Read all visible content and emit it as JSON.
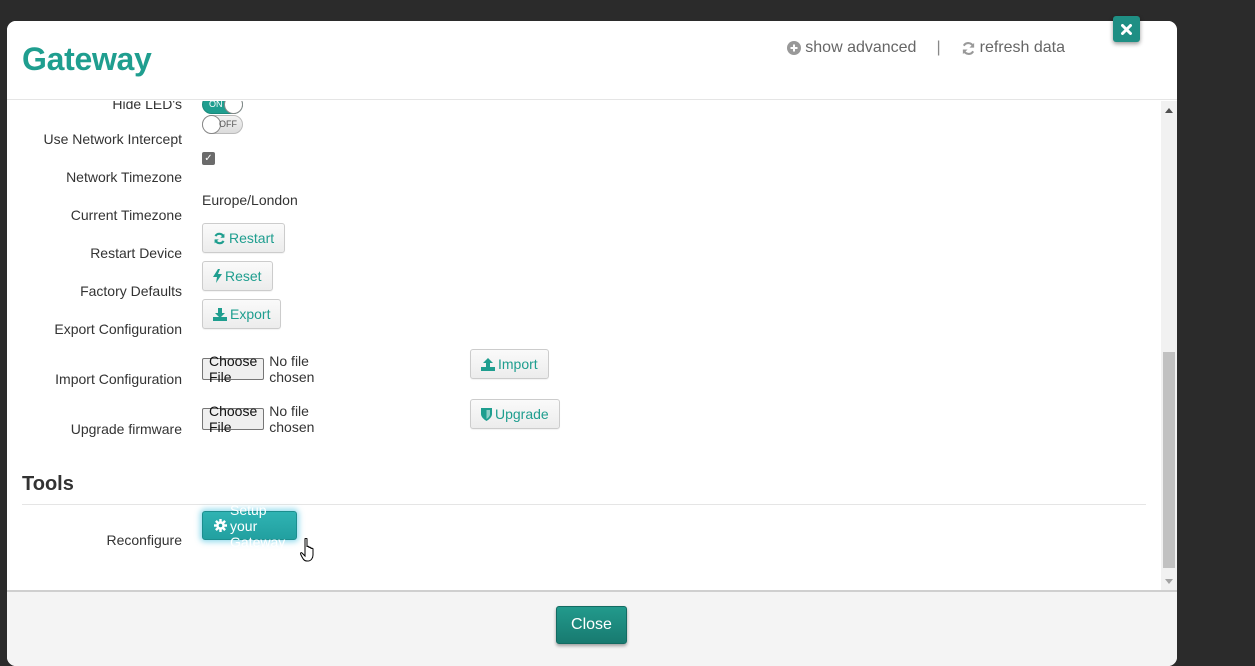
{
  "modal": {
    "title": "Gateway",
    "header_links": {
      "show_advanced": "show advanced",
      "separator": "|",
      "refresh_data": "refresh data"
    }
  },
  "settings": {
    "hide_leds": {
      "label": "Hide LED's",
      "state": "ON"
    },
    "network_intercept": {
      "label": "Use Network Intercept",
      "state": "OFF"
    },
    "network_timezone": {
      "label": "Network Timezone",
      "checked": true
    },
    "current_timezone": {
      "label": "Current Timezone",
      "value": "Europe/London"
    },
    "restart_device": {
      "label": "Restart Device",
      "button": "Restart"
    },
    "factory_defaults": {
      "label": "Factory Defaults",
      "button": "Reset"
    },
    "export_configuration": {
      "label": "Export Configuration",
      "button": "Export"
    },
    "import_configuration": {
      "label": "Import Configuration",
      "file_button": "Choose File",
      "file_status": "No file chosen",
      "button": "Import"
    },
    "upgrade_firmware": {
      "label": "Upgrade firmware",
      "file_button": "Choose File",
      "file_status": "No file chosen",
      "button": "Upgrade"
    }
  },
  "tools": {
    "title": "Tools",
    "reconfigure": {
      "label": "Reconfigure",
      "button": "Setup your Gateway"
    }
  },
  "footer": {
    "close_label": "Close"
  },
  "colors": {
    "accent": "#1f9e8f",
    "primary_button": "#22a0a0"
  }
}
